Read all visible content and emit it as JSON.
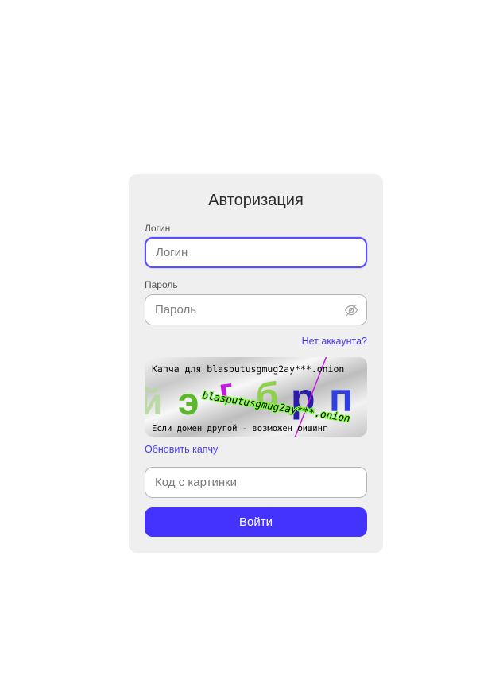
{
  "form": {
    "title": "Авторизация",
    "login_label": "Логин",
    "login_placeholder": "Логин",
    "password_label": "Пароль",
    "password_placeholder": "Пароль",
    "no_account_link": "Нет аккаунта?",
    "captcha": {
      "header_text": "Капча для blasputusgmug2ay***.onion",
      "overlay_domain": "blasputusgmug2ay***.onion",
      "footer_text": "Если домен другой - возможен фишинг",
      "letters": [
        "й",
        "э",
        "г",
        "б",
        "р",
        "п"
      ]
    },
    "refresh_captcha_link": "Обновить капчу",
    "captcha_code_placeholder": "Код с картинки",
    "submit_label": "Войти"
  },
  "colors": {
    "accent": "#4433ff",
    "link": "#4a3cf0",
    "card_bg": "#efefef"
  },
  "icons": {
    "password_toggle": "eye-off-icon"
  }
}
